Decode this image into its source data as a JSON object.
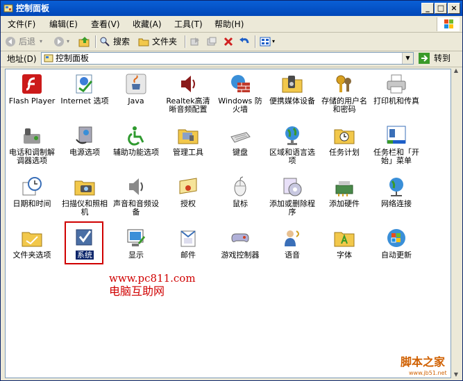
{
  "window": {
    "title": "控制面板"
  },
  "title_buttons": {
    "minimize": "_",
    "maximize": "□",
    "close": "×"
  },
  "menubar": {
    "items": [
      "文件(F)",
      "编辑(E)",
      "查看(V)",
      "收藏(A)",
      "工具(T)",
      "帮助(H)"
    ]
  },
  "toolbar": {
    "back": "后退",
    "search": "搜索",
    "folders": "文件夹"
  },
  "addressbar": {
    "label": "地址(D)",
    "value": "控制面板",
    "go": "转到"
  },
  "items": [
    {
      "label": "Flash Player",
      "icon": "flash-icon"
    },
    {
      "label": "Internet 选项",
      "icon": "internet-options-icon"
    },
    {
      "label": "Java",
      "icon": "java-icon"
    },
    {
      "label": "Realtek高清晰音频配置",
      "icon": "speaker-icon"
    },
    {
      "label": "Windows 防火墙",
      "icon": "firewall-icon"
    },
    {
      "label": "便携媒体设备",
      "icon": "portable-media-icon"
    },
    {
      "label": "存储的用户名和密码",
      "icon": "keys-icon"
    },
    {
      "label": "打印机和传真",
      "icon": "printer-icon"
    },
    {
      "label": "电话和调制解调器选项",
      "icon": "phone-modem-icon"
    },
    {
      "label": "电源选项",
      "icon": "power-icon"
    },
    {
      "label": "辅助功能选项",
      "icon": "accessibility-icon"
    },
    {
      "label": "管理工具",
      "icon": "admin-tools-icon"
    },
    {
      "label": "键盘",
      "icon": "keyboard-icon"
    },
    {
      "label": "区域和语言选项",
      "icon": "globe-icon"
    },
    {
      "label": "任务计划",
      "icon": "scheduled-tasks-icon"
    },
    {
      "label": "任务栏和「开始」菜单",
      "icon": "taskbar-icon"
    },
    {
      "label": "日期和时间",
      "icon": "clock-icon"
    },
    {
      "label": "扫描仪和照相机",
      "icon": "scanner-camera-icon"
    },
    {
      "label": "声音和音频设备",
      "icon": "sound-icon"
    },
    {
      "label": "授权",
      "icon": "certificate-icon"
    },
    {
      "label": "鼠标",
      "icon": "mouse-icon"
    },
    {
      "label": "添加或删除程序",
      "icon": "add-remove-icon"
    },
    {
      "label": "添加硬件",
      "icon": "add-hardware-icon"
    },
    {
      "label": "网络连接",
      "icon": "network-icon"
    },
    {
      "label": "文件夹选项",
      "icon": "folder-options-icon"
    },
    {
      "label": "系统",
      "icon": "system-icon"
    },
    {
      "label": "显示",
      "icon": "display-icon"
    },
    {
      "label": "邮件",
      "icon": "mail-icon"
    },
    {
      "label": "游戏控制器",
      "icon": "gamepad-icon"
    },
    {
      "label": "语音",
      "icon": "speech-icon"
    },
    {
      "label": "字体",
      "icon": "fonts-icon"
    },
    {
      "label": "自动更新",
      "icon": "windows-update-icon"
    }
  ],
  "watermark": {
    "url": "www.pc811.com",
    "site": "电脑互助网",
    "brand": "脚本之家",
    "brand_url": "www.jb51.net"
  },
  "colors": {
    "title_bar": "#0a5fd6",
    "selection": "#0a246a",
    "highlight_box": "#d00000"
  }
}
